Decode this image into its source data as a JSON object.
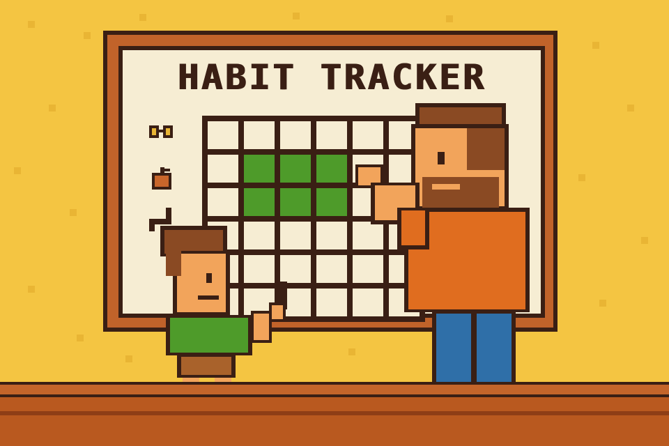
{
  "scene": {
    "board_title": "HABIT TRACKER",
    "colors": {
      "wall": "#F4C542",
      "board_frame": "#C1632A",
      "board_paper": "#F6EDD3",
      "outline": "#3A1F14",
      "check_green": "#4E9B2A",
      "floor": "#B9591F"
    }
  },
  "tracker": {
    "rows": 6,
    "columns": 6,
    "completed_cells": [
      [
        1,
        1
      ],
      [
        1,
        2
      ],
      [
        1,
        3
      ],
      [
        2,
        1
      ],
      [
        2,
        2
      ],
      [
        2,
        3
      ]
    ],
    "row_icons": [
      "glasses-icon",
      "apple-icon",
      "arrow-icon"
    ]
  },
  "characters": {
    "adult": {
      "shirt": "#E06D1F",
      "pants": "#2F6FA8",
      "hair": "#8A4A23"
    },
    "child": {
      "shirt": "#4E9B2A",
      "shorts": "#A9622B",
      "hair": "#8A4A23"
    }
  }
}
